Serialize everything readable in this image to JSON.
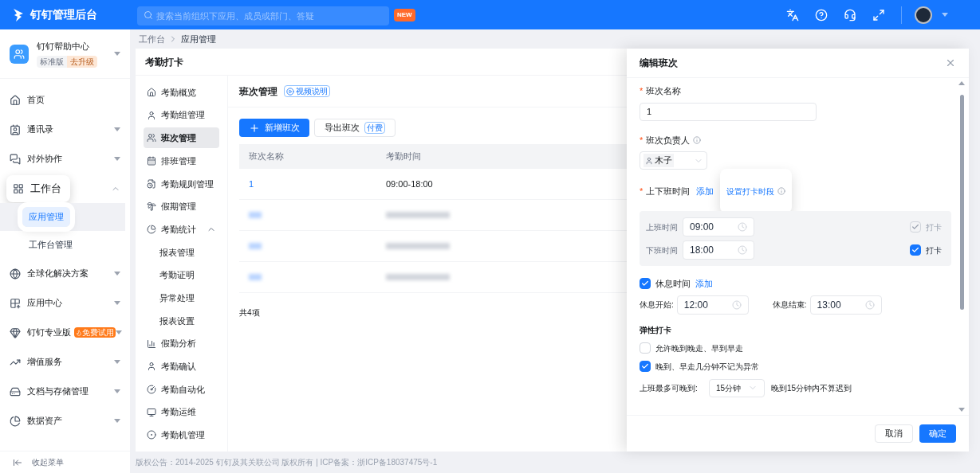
{
  "header": {
    "logo_text": "钉钉管理后台",
    "search_placeholder": "搜索当前组织下应用、成员或部门、答疑",
    "new_badge": "NEW"
  },
  "org": {
    "name": "钉钉帮助中心",
    "edition": "标准版",
    "upgrade": "去升级"
  },
  "sidebar": {
    "items": [
      {
        "label": "首页",
        "has_caret": false
      },
      {
        "label": "通讯录",
        "expanded": false,
        "has_caret": true
      },
      {
        "label": "对外协作",
        "expanded": false,
        "has_caret": true
      },
      {
        "label": "工作台",
        "expanded": true,
        "has_caret": true,
        "highlighted": true,
        "children": [
          {
            "label": "应用管理",
            "selected": true
          },
          {
            "label": "工作台管理",
            "selected": false
          }
        ]
      },
      {
        "label": "全球化解决方案",
        "expanded": false,
        "has_caret": true
      },
      {
        "label": "应用中心",
        "expanded": false,
        "has_caret": true
      },
      {
        "label": "钉钉专业版",
        "expanded": false,
        "has_caret": true,
        "badge": "免费试用"
      },
      {
        "label": "增值服务",
        "expanded": false,
        "has_caret": true
      },
      {
        "label": "文档与存储管理",
        "expanded": false,
        "has_caret": true
      },
      {
        "label": "数据资产",
        "expanded": false,
        "has_caret": true
      }
    ],
    "collapse": "收起菜单"
  },
  "breadcrumb": [
    "工作台",
    "应用管理"
  ],
  "card_title": "考勤打卡",
  "submenu": [
    {
      "label": "考勤概览",
      "selected": false
    },
    {
      "label": "考勤组管理",
      "selected": false
    },
    {
      "label": "班次管理",
      "selected": true
    },
    {
      "label": "排班管理",
      "selected": false
    },
    {
      "label": "考勤规则管理",
      "selected": false
    },
    {
      "label": "假期管理",
      "selected": false
    },
    {
      "label": "考勤统计",
      "selected": false,
      "expanded": true,
      "children": [
        {
          "label": "报表管理",
          "selected": false
        },
        {
          "label": "考勤证明",
          "selected": false
        },
        {
          "label": "异常处理",
          "selected": false
        },
        {
          "label": "报表设置",
          "selected": false
        }
      ]
    },
    {
      "label": "假勤分析",
      "selected": false
    },
    {
      "label": "考勤确认",
      "selected": false
    },
    {
      "label": "考勤自动化",
      "selected": false
    },
    {
      "label": "考勤运维",
      "selected": false
    },
    {
      "label": "考勤机管理",
      "selected": false
    }
  ],
  "section_title": "班次管理",
  "video_badge": "视频说明",
  "add_button": "新增班次",
  "export_button": "导出班次",
  "export_tag": "付费",
  "table": {
    "columns": [
      "班次名称",
      "考勤时间"
    ],
    "rows": [
      {
        "name": "1",
        "time": "09:00-18:00",
        "blurred": false
      },
      {
        "blurred": true
      },
      {
        "blurred": true
      },
      {
        "blurred": true
      }
    ]
  },
  "total": "共4项",
  "footer": "版权公告：2014-2025 钉钉及其关联公司 版权所有 | ICP备案：浙ICP备18037475号-1",
  "drawer": {
    "title": "编辑班次",
    "name_label": {
      "mark": "*",
      "text": "班次名称"
    },
    "name_value": "1",
    "owner_label": {
      "mark": "*",
      "text": "班次负责人"
    },
    "owner_value": "木子",
    "time_label": {
      "mark": "*",
      "text": "上下班时间"
    },
    "time_add": "添加",
    "time_slot_link": "设置打卡时段",
    "time_rows": [
      {
        "label": "上班时间",
        "value": "09:00",
        "check_label": "打卡",
        "checked": true,
        "disabled": true
      },
      {
        "label": "下班时间",
        "value": "18:00",
        "check_label": "打卡",
        "checked": true,
        "disabled": false
      }
    ],
    "rest": {
      "checked": true,
      "label": "休息时间",
      "add": "添加",
      "start_label": "休息开始:",
      "start_value": "12:00",
      "end_label": "休息结束:",
      "end_value": "13:00"
    },
    "flex_title": "弹性打卡",
    "flex_options": [
      {
        "label": "允许晚到晚走、早到早走",
        "checked": false
      },
      {
        "label": "晚到、早走几分钟不记为异常",
        "checked": true
      }
    ],
    "late": {
      "label": "上班最多可晚到:",
      "value": "15分钟",
      "note": "晚到15分钟内不算迟到"
    },
    "cancel": "取消",
    "confirm": "确定"
  }
}
